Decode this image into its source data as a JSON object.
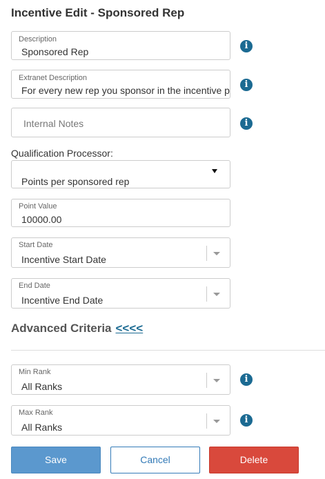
{
  "page": {
    "title": "Incentive Edit - Sponsored Rep"
  },
  "description": {
    "label": "Description",
    "value": "Sponsored Rep"
  },
  "extranet_description": {
    "label": "Extranet Description",
    "value": "For every new rep you sponsor in the incentive per"
  },
  "internal_notes": {
    "placeholder": "Internal Notes"
  },
  "qualification_processor": {
    "label": "Qualification Processor:",
    "value": "Points per sponsored rep"
  },
  "point_value": {
    "label": "Point Value",
    "value": "10000.00"
  },
  "start_date": {
    "label": "Start Date",
    "value": "Incentive Start Date"
  },
  "end_date": {
    "label": "End Date",
    "value": "Incentive End Date"
  },
  "advanced": {
    "title": "Advanced Criteria",
    "toggle": "<<<<"
  },
  "min_rank": {
    "label": "Min Rank",
    "value": "All Ranks"
  },
  "max_rank": {
    "label": "Max Rank",
    "value": "All Ranks"
  },
  "buttons": {
    "save": "Save",
    "cancel": "Cancel",
    "delete": "Delete"
  },
  "icons": {
    "info": "info-icon",
    "dropdown": "chevron-down-icon",
    "caret": "caret-down-icon"
  },
  "colors": {
    "info": "#1b6a92",
    "save": "#5b98ce",
    "cancel_border": "#337ab7",
    "delete": "#d9493c"
  }
}
